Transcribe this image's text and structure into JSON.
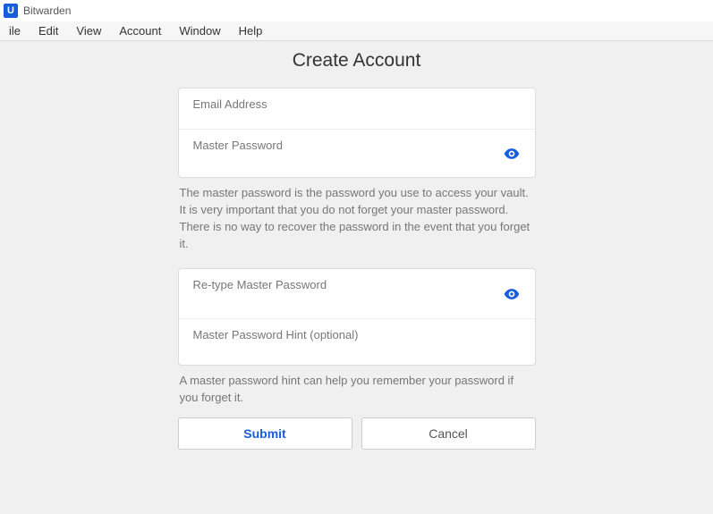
{
  "window": {
    "app_title": "Bitwarden",
    "icon_letter": "U"
  },
  "menu": {
    "items": [
      "ile",
      "Edit",
      "View",
      "Account",
      "Window",
      "Help"
    ]
  },
  "page": {
    "title": "Create Account"
  },
  "fields": {
    "email_label": "Email Address",
    "master_pw_label": "Master Password",
    "master_pw_help": "The master password is the password you use to access your vault. It is very important that you do not forget your master password. There is no way to recover the password in the event that you forget it.",
    "retype_label": "Re-type Master Password",
    "hint_label": "Master Password Hint (optional)",
    "hint_help": "A master password hint can help you remember your password if you forget it."
  },
  "buttons": {
    "submit": "Submit",
    "cancel": "Cancel"
  }
}
